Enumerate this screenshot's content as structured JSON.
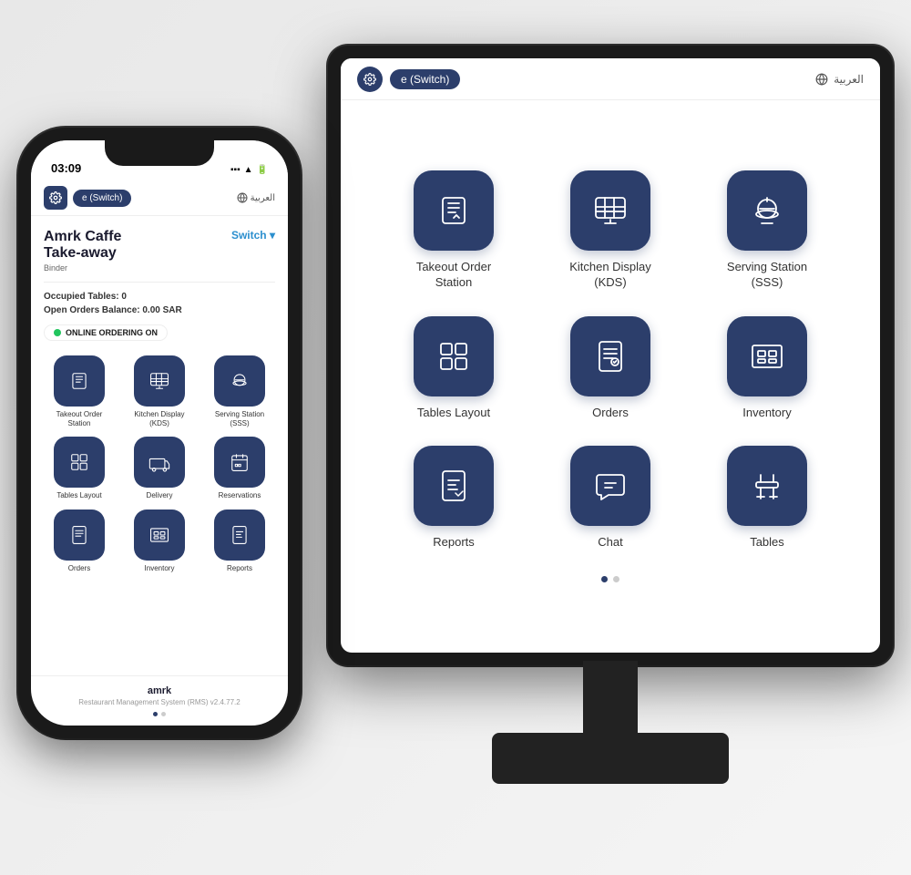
{
  "monitor": {
    "header": {
      "switch_label": "e (Switch)",
      "arabic_label": "العربية",
      "user_icon": "👤"
    },
    "apps": [
      {
        "id": "takeout",
        "label": "Takeout Order\nStation",
        "icon": "takeout"
      },
      {
        "id": "kds",
        "label": "Kitchen Display\n(KDS)",
        "icon": "kds"
      },
      {
        "id": "serving",
        "label": "Serving Station\n(SSS)",
        "icon": "serving"
      },
      {
        "id": "tables-layout",
        "label": "Tables Layout",
        "icon": "tables-layout"
      },
      {
        "id": "orders",
        "label": "Orders",
        "icon": "orders"
      },
      {
        "id": "inventory",
        "label": "Inventory",
        "icon": "inventory"
      },
      {
        "id": "reports",
        "label": "Reports",
        "icon": "reports"
      },
      {
        "id": "chat",
        "label": "Chat",
        "icon": "chat"
      },
      {
        "id": "tables",
        "label": "Tables",
        "icon": "tables"
      }
    ],
    "pagination": {
      "active": 0,
      "total": 2
    }
  },
  "phone": {
    "time": "03:09",
    "restaurant_name": "Amrk Caffe\nTake-away",
    "role": "Binder",
    "switch_label": "Switch",
    "occupied_tables": "0",
    "open_orders": "0.00 SAR",
    "online_status": "ONLINE ORDERING ON",
    "arabic_label": "العربية",
    "switch_btn_label": "e (Switch)",
    "apps": [
      {
        "id": "takeout",
        "label": "Takeout Order\nStation",
        "icon": "takeout"
      },
      {
        "id": "kds",
        "label": "Kitchen Display\n(KDS)",
        "icon": "kds"
      },
      {
        "id": "serving",
        "label": "Serving Station\n(SSS)",
        "icon": "serving"
      },
      {
        "id": "tables-layout",
        "label": "Tables Layout",
        "icon": "tables-layout"
      },
      {
        "id": "delivery",
        "label": "Delivery",
        "icon": "delivery"
      },
      {
        "id": "reservations",
        "label": "Reservations",
        "icon": "reservations"
      },
      {
        "id": "orders",
        "label": "Orders",
        "icon": "orders"
      },
      {
        "id": "inventory",
        "label": "Inventory",
        "icon": "inventory"
      },
      {
        "id": "reports",
        "label": "Reports",
        "icon": "reports"
      }
    ],
    "brand": "amrk",
    "version": "Restaurant Management System (RMS) v2.4.77.2",
    "pagination": {
      "active": 0,
      "total": 2
    }
  }
}
